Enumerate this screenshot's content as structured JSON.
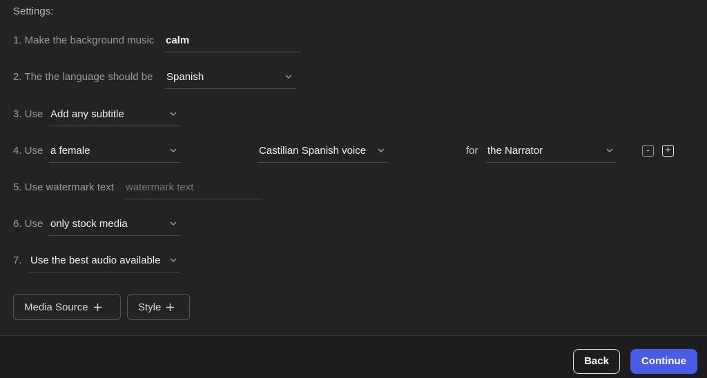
{
  "settings": {
    "heading": "Settings:",
    "row1": {
      "label": "1. Make the background music",
      "value": "calm"
    },
    "row2": {
      "label": "2. The the language should be",
      "value": "Spanish"
    },
    "row3": {
      "label": "3. Use",
      "value": "Add any subtitle"
    },
    "row4": {
      "label": "4. Use",
      "gender": "a female",
      "voice": "Castilian Spanish voice",
      "for_label": "for",
      "role": "the Narrator",
      "minus_label": "-",
      "plus_label": "+"
    },
    "row5": {
      "label": "5. Use watermark text",
      "placeholder": "watermark text"
    },
    "row6": {
      "label": "6. Use",
      "value": "only stock media"
    },
    "row7": {
      "label": "7.",
      "value": "Use the best audio available"
    }
  },
  "actions": {
    "media_source": "Media Source",
    "style": "Style"
  },
  "footer": {
    "back": "Back",
    "continue": "Continue"
  },
  "icons": {
    "chevron": "chevron-down-icon",
    "plus": "plus-icon"
  },
  "colors": {
    "background": "#232325",
    "accent": "#4a5ce6"
  }
}
